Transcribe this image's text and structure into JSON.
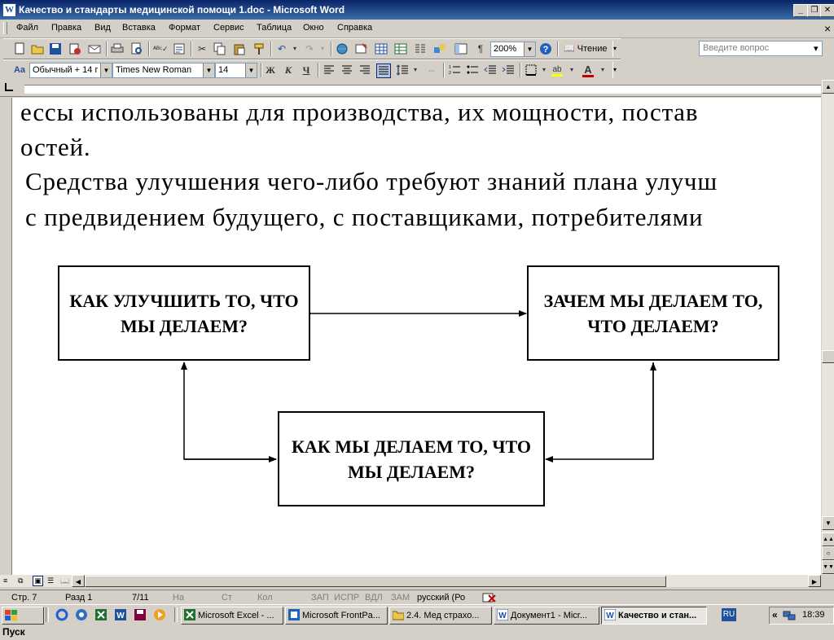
{
  "window": {
    "title": "Качество и стандарты медицинской помощи 1.doc - Microsoft Word",
    "app_icon": "word-doc-icon",
    "controls": {
      "minimize": "_",
      "restore": "❐",
      "close": "✕"
    }
  },
  "menu": {
    "items": [
      "Файл",
      "Правка",
      "Вид",
      "Вставка",
      "Формат",
      "Сервис",
      "Таблица",
      "Окно",
      "Справка"
    ],
    "help_placeholder": "Введите вопрос",
    "close_doc": "×"
  },
  "standard_toolbar": {
    "zoom": "200%",
    "reading_mode": "Чтение",
    "pilcrow": "¶"
  },
  "formatting_toolbar": {
    "style": "Обычный + 14 г",
    "font": "Times New Roman",
    "size": "14",
    "bold": "Ж",
    "italic": "К",
    "underline": "Ч",
    "font_color_letter": "A",
    "highlight_letter": "ab",
    "style_icon_letters": "Aa"
  },
  "document": {
    "lines": [
      "ессы  использованы  для  производства,  их  мощности,  постав",
      "остей.",
      "Средства улучшения чего-либо требуют знаний плана улучш",
      "с предвидением будущего, с поставщиками, потребителями"
    ],
    "diagram": {
      "box_left": "КАК УЛУЧШИТЬ ТО, ЧТО МЫ ДЕЛАЕМ?",
      "box_right": "ЗАЧЕМ МЫ ДЕЛАЕМ ТО, ЧТО ДЕЛАЕМ?",
      "box_bottom": "КАК МЫ ДЕЛАЕМ ТО, ЧТО МЫ ДЕЛАЕМ?"
    }
  },
  "status_bar": {
    "page": "Стр. 7",
    "section": "Разд 1",
    "pages": "7/11",
    "at": "На",
    "line": "Ст",
    "col": "Кол",
    "rec": "ЗАП",
    "trk": "ИСПР",
    "ext": "ВДЛ",
    "ovr": "ЗАМ",
    "language": "русский (Ро"
  },
  "taskbar": {
    "start": "Пуск",
    "tasks": [
      {
        "label": "Microsoft Excel - ...",
        "icon": "excel-icon",
        "active": false
      },
      {
        "label": "Microsoft FrontPa...",
        "icon": "frontpage-icon",
        "active": false
      },
      {
        "label": "2.4. Мед страхо...",
        "icon": "folder-icon",
        "active": false
      },
      {
        "label": "Документ1 - Micr...",
        "icon": "word-icon",
        "active": false
      },
      {
        "label": "Качество и стан...",
        "icon": "word-icon",
        "active": true
      }
    ],
    "language": "RU",
    "clock": "18:39",
    "chevron": "«"
  }
}
